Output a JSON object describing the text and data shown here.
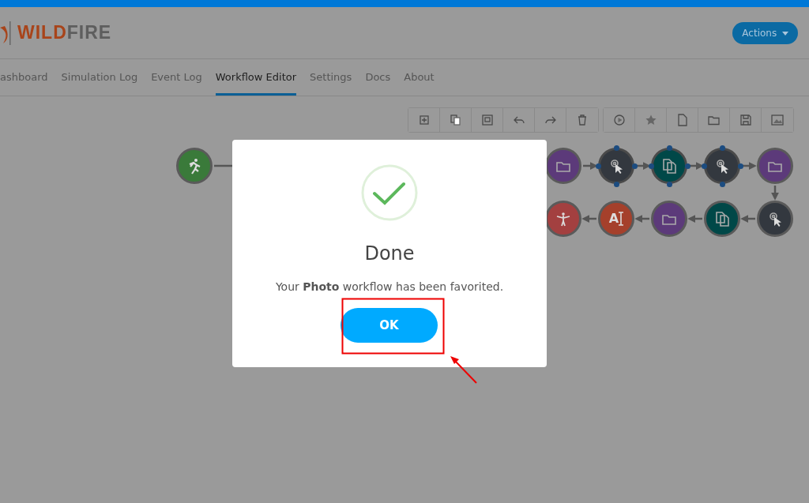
{
  "logo": {
    "accent": "WILD",
    "rest": "FIRE"
  },
  "actions_button": {
    "label": "Actions"
  },
  "tabs": [
    {
      "label": "ashboard",
      "selected": false
    },
    {
      "label": "Simulation Log",
      "selected": false
    },
    {
      "label": "Event Log",
      "selected": false
    },
    {
      "label": "Workflow Editor",
      "selected": true
    },
    {
      "label": "Settings",
      "selected": false
    },
    {
      "label": "Docs",
      "selected": false
    },
    {
      "label": "About",
      "selected": false
    }
  ],
  "workflow": {
    "row_1": [
      {
        "kind": "start",
        "color": "#3a7a3a",
        "selected": false
      },
      {
        "kind": "folder",
        "color": "#5c3a7a",
        "selected": false
      },
      {
        "kind": "pointer",
        "color": "#33383f",
        "selected": true
      },
      {
        "kind": "copy",
        "color": "#004848",
        "selected": true
      },
      {
        "kind": "pointer",
        "color": "#33383f",
        "selected": true
      },
      {
        "kind": "folder",
        "color": "#5c3a7a",
        "selected": false
      }
    ],
    "row_2": [
      {
        "kind": "pointer",
        "color": "#33383f",
        "selected": false
      },
      {
        "kind": "copy",
        "color": "#004848",
        "selected": false
      },
      {
        "kind": "folder",
        "color": "#5c3a7a",
        "selected": false
      },
      {
        "kind": "text",
        "color": "#a5402b",
        "glyph": "A",
        "selected": false
      },
      {
        "kind": "finish",
        "color": "#a34040",
        "selected": false
      }
    ]
  },
  "dialog": {
    "title": "Done",
    "message": "Your **Photo** workflow has been favorited.",
    "button": "OK"
  }
}
